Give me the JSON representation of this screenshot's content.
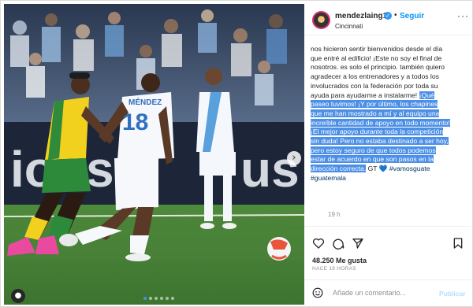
{
  "header": {
    "username": "mendezlaing11",
    "separator": "•",
    "follow_label": "Seguir",
    "location": "Cincinnati",
    "more_icon": "more-horizontal-icon"
  },
  "caption": {
    "text_plain": "nos hicieron sentir bienvenidos desde el día que entré al edificio! ¡Este no soy el final de nosotros. es solo el principio. también quiero agradecer a los entrenadores y a todos los involucrados con la federación por toda su ayuda para ayudarme a instalarme! ",
    "text_highlight": "¡Qué paseo tuvimos! ¡Y por último, los chapines que me han mostrado a mí y al equipo una increíble cantidad de apoyo en todo momento! ¡El mejor apoyo durante toda la competición sin duda! Pero no estaba destinado a ser hoy, pero estoy seguro de que todos podemos estar de acuerdo en que son pasos en la dirección correcta.",
    "suffix": " GT",
    "heart": "💙",
    "hashtag_1": "#vamosguate",
    "hashtag_2": "#guatemala"
  },
  "post": {
    "time_ago_short": "19 h",
    "likes": "48.250 Me gusta",
    "time_ago_full": "HACE 19 HORAS"
  },
  "comment": {
    "placeholder": "Añade un comentario...",
    "publish_label": "Publicar"
  },
  "colors": {
    "accent": "#0095f6",
    "highlight": "#4c8fe6",
    "hashtag": "#00376b"
  },
  "photo": {
    "jersey_name": "MÉNDEZ",
    "jersey_number": "18"
  }
}
